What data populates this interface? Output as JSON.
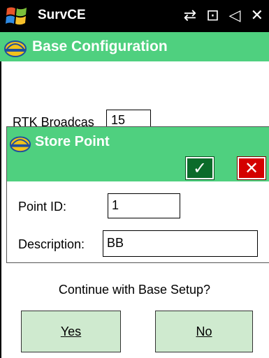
{
  "topbar": {
    "app_title": "SurvCE",
    "status_icons": [
      "connectivity-icon",
      "sync-icon",
      "volume-icon",
      "close-icon"
    ],
    "status_glyphs": [
      "⇄",
      "⊡",
      "◁",
      "✕"
    ]
  },
  "window": {
    "title": "Base Configuration",
    "rtk_label": "RTK Broadcas",
    "rtk_value": "15"
  },
  "dialog": {
    "title": "Store Point",
    "ok_glyph": "✓",
    "cancel_glyph": "✕",
    "point_id_label": "Point ID:",
    "point_id_value": "1",
    "description_label": "Description:",
    "description_value": "BB"
  },
  "prompt": {
    "text": "Continue with Base Setup?",
    "yes_label": "Yes",
    "no_label": "No"
  },
  "colors": {
    "titlebar": "#4fd07f",
    "ok": "#0b6b2a",
    "cancel": "#d40000",
    "button_bg": "#cfeacf"
  }
}
